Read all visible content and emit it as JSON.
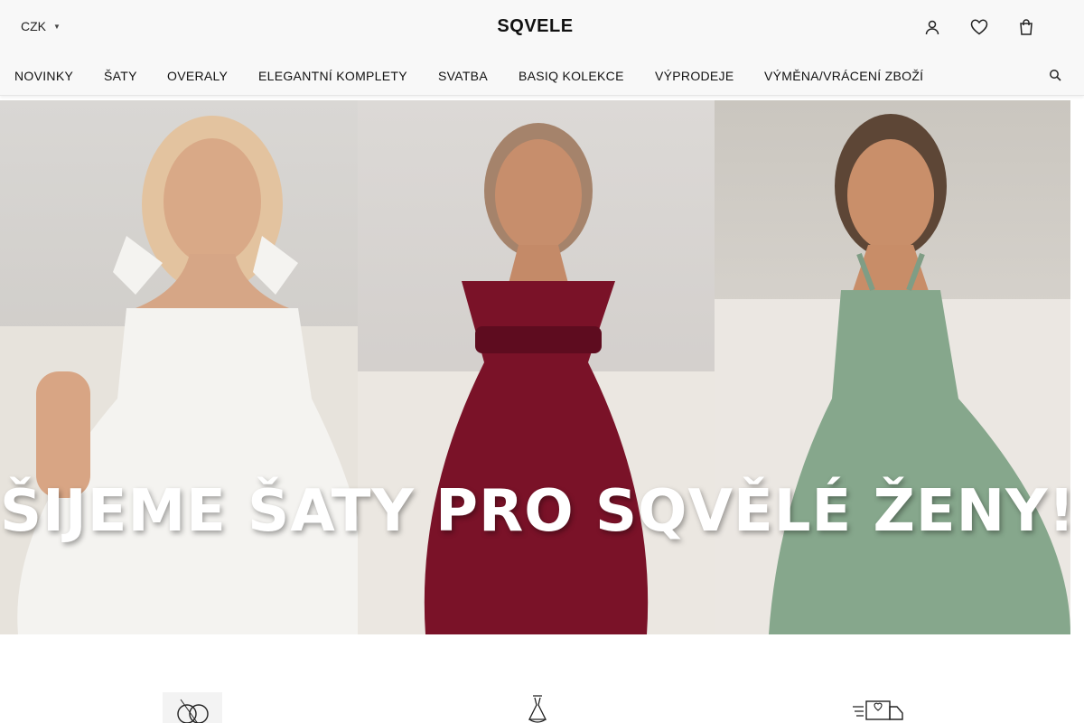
{
  "header": {
    "currency": "CZK",
    "logo": "SQVELE",
    "icons": [
      "user-icon",
      "heart-icon",
      "cart-icon"
    ]
  },
  "nav": {
    "items": [
      "NOVINKY",
      "ŠATY",
      "OVERALY",
      "ELEGANTNÍ KOMPLETY",
      "SVATBA",
      "BASIQ KOLEKCE",
      "VÝPRODEJE",
      "VÝMĚNA/VRÁCENÍ ZBOŽÍ"
    ],
    "search_icon": "search-icon"
  },
  "hero": {
    "title": "ŠIJEME ŠATY PRO SQVĚLÉ ŽENY!",
    "panels": [
      {
        "dress_color": "#f4f3f0"
      },
      {
        "dress_color": "#7a1228"
      },
      {
        "dress_color": "#86a78c"
      }
    ]
  },
  "features": {
    "icons": [
      "rings-icon",
      "dress-icon",
      "delivery-truck-icon"
    ]
  }
}
